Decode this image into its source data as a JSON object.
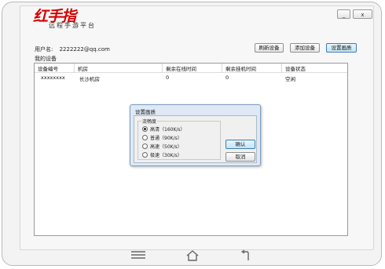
{
  "app": {
    "logo_text": "红手指",
    "subtitle": "远程手游平台",
    "minimize_label": "_",
    "close_label": "x"
  },
  "user": {
    "label": "用户名:",
    "value": "2222222@qq.com"
  },
  "toolbar": {
    "refresh_label": "刷新设备",
    "add_label": "添加设备",
    "quality_label": "设置画质"
  },
  "devices_section": {
    "title": "我的设备",
    "columns": [
      "设备编号",
      "机房",
      "剩余在线时间",
      "剩余挂机时间",
      "设备状态"
    ],
    "rows": [
      [
        "xxxxxxxx",
        "长沙机房",
        "0",
        "0",
        "空闲"
      ]
    ]
  },
  "dialog": {
    "title": "设置画质",
    "group_title": "流畅度",
    "options": [
      {
        "label": "高清（160K/s）",
        "checked": true
      },
      {
        "label": "普通（90K/s）",
        "checked": false
      },
      {
        "label": "高速（50K/s）",
        "checked": false
      },
      {
        "label": "极速（30K/s）",
        "checked": false
      }
    ],
    "confirm_label": "确认",
    "cancel_label": "取消"
  },
  "nav": {
    "icons": [
      "menu-icon",
      "home-icon",
      "back-icon"
    ]
  }
}
